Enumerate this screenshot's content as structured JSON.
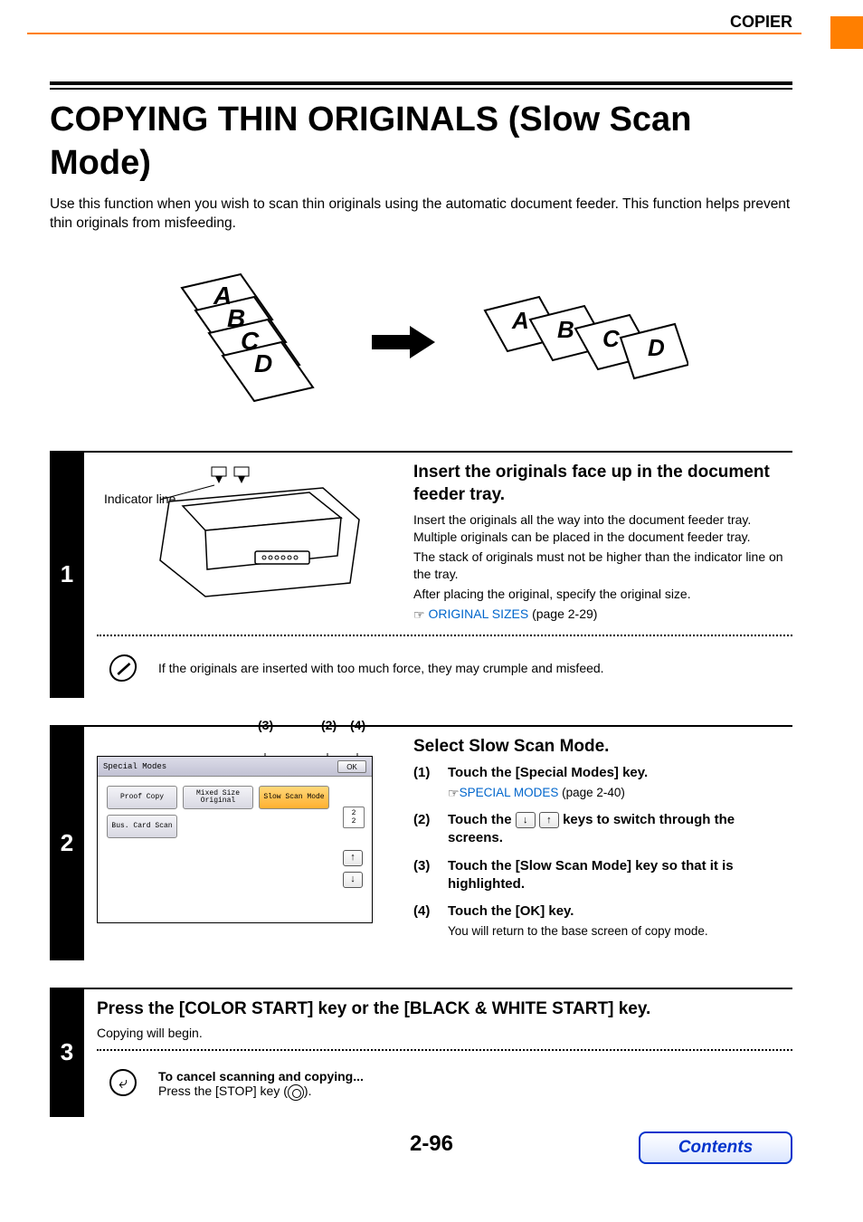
{
  "header": {
    "section": "COPIER"
  },
  "title": "COPYING THIN ORIGINALS (Slow Scan Mode)",
  "intro": "Use this function when you wish to scan thin originals using the automatic document feeder. This function helps prevent thin originals from misfeeding.",
  "diagram": {
    "indicator_label": "Indicator line",
    "letters": [
      "A",
      "B",
      "C",
      "D"
    ]
  },
  "steps": [
    {
      "num": "1",
      "heading": "Insert the originals face up in the document feeder tray.",
      "body": [
        "Insert the originals all the way into the document feeder tray. Multiple originals can be placed in the document feeder tray.",
        "The stack of originals must not be higher than the indicator line on the tray.",
        "After placing the original, specify the original size."
      ],
      "link": {
        "text": "ORIGINAL SIZES",
        "ref": " (page 2-29)"
      },
      "note": "If the originals are inserted with too much force, they may crumple and misfeed."
    },
    {
      "num": "2",
      "heading": "Select Slow Scan Mode.",
      "callouts": {
        "c3": "(3)",
        "c2": "(2)",
        "c4": "(4)"
      },
      "screen": {
        "title": "Special Modes",
        "ok": "OK",
        "buttons": {
          "proof": "Proof Copy",
          "mixed": "Mixed Size Original",
          "slow": "Slow Scan Mode",
          "bus": "Bus. Card Scan"
        },
        "page_ind": "2\n2"
      },
      "sub": [
        {
          "n": "(1)",
          "t": "Touch the [Special Modes] key.",
          "link": {
            "text": "SPECIAL MODES",
            "ref": " (page 2-40)"
          }
        },
        {
          "n": "(2)",
          "t_before": "Touch the ",
          "t_after": " keys to switch through the screens."
        },
        {
          "n": "(3)",
          "t": "Touch the [Slow Scan Mode] key so that it is highlighted."
        },
        {
          "n": "(4)",
          "t": "Touch the [OK] key.",
          "desc": "You will return to the base screen of copy mode."
        }
      ]
    },
    {
      "num": "3",
      "heading": "Press the [COLOR START] key or the [BLACK & WHITE START] key.",
      "body_line": "Copying will begin.",
      "cancel_head": "To cancel scanning and copying...",
      "cancel_body_before": "Press the [STOP] key (",
      "cancel_body_after": ")."
    }
  ],
  "footer": {
    "page": "2-96",
    "contents": "Contents"
  }
}
